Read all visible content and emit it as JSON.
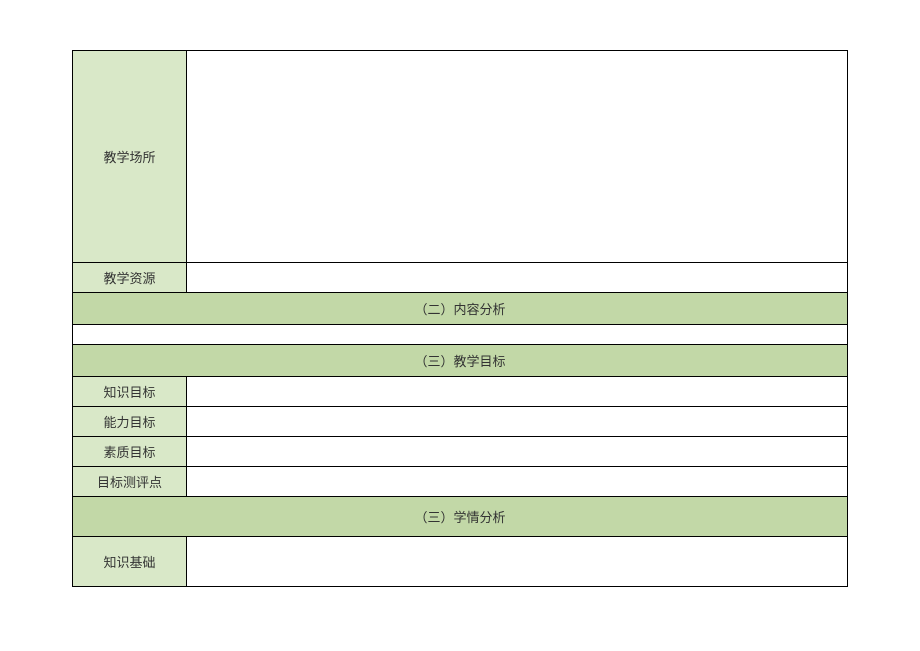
{
  "rows": {
    "teaching_place": {
      "label": "教学场所",
      "value": ""
    },
    "teaching_resources": {
      "label": "教学资源",
      "value": ""
    },
    "section_content_analysis": "（二）内容分析",
    "content_analysis_value": "",
    "section_teaching_objectives": "（三）教学目标",
    "knowledge_objective": {
      "label": "知识目标",
      "value": ""
    },
    "ability_objective": {
      "label": "能力目标",
      "value": ""
    },
    "quality_objective": {
      "label": "素质目标",
      "value": ""
    },
    "assessment_points": {
      "label": "目标测评点",
      "value": ""
    },
    "section_student_analysis": "（三）学情分析",
    "knowledge_base": {
      "label": "知识基础",
      "value": ""
    }
  }
}
